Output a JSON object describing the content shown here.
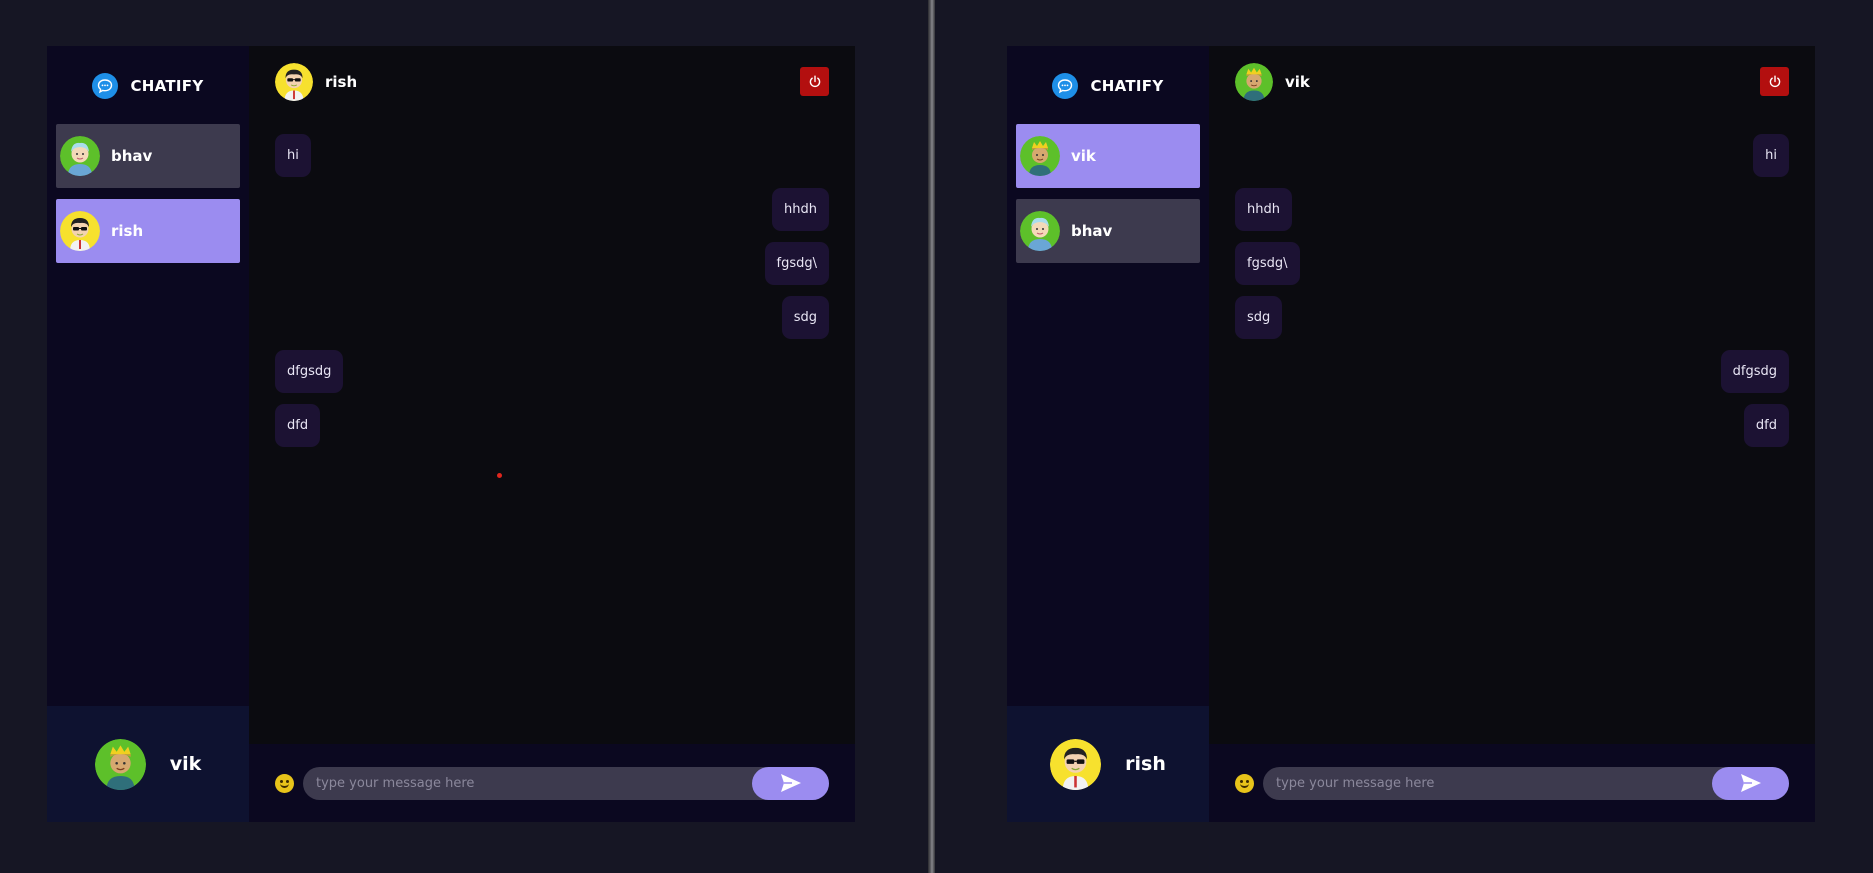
{
  "colors": {
    "background": "#161624",
    "sidebar": "#0b0820",
    "chat_bg": "#0b0b10",
    "active_contact": "#9b8cf0",
    "inactive_contact": "#3d3a4e",
    "bubble": "#1c1233",
    "logout": "#b30f0f",
    "brand_icon": "#1e8fe8"
  },
  "windows": [
    {
      "brand": {
        "name": "CHATIFY",
        "icon": "chat-bubble-icon"
      },
      "contacts": [
        {
          "name": "bhav",
          "avatar": "avatar-bhav",
          "active": false
        },
        {
          "name": "rish",
          "avatar": "avatar-rish",
          "active": true
        }
      ],
      "current_user": {
        "name": "vik",
        "avatar": "avatar-vik"
      },
      "chat": {
        "partner": {
          "name": "rish",
          "avatar": "avatar-rish"
        },
        "logout_icon": "power-icon",
        "messages": [
          {
            "text": "hi",
            "direction": "in"
          },
          {
            "text": "hhdh",
            "direction": "out"
          },
          {
            "text": "fgsdg\\",
            "direction": "out"
          },
          {
            "text": "sdg",
            "direction": "out"
          },
          {
            "text": "dfgsdg",
            "direction": "in"
          },
          {
            "text": "dfd",
            "direction": "in"
          }
        ],
        "composer": {
          "placeholder": "type your message here",
          "emoji_icon": "smiley-icon",
          "send_icon": "send-icon"
        }
      }
    },
    {
      "brand": {
        "name": "CHATIFY",
        "icon": "chat-bubble-icon"
      },
      "contacts": [
        {
          "name": "vik",
          "avatar": "avatar-vik",
          "active": true
        },
        {
          "name": "bhav",
          "avatar": "avatar-bhav",
          "active": false
        }
      ],
      "current_user": {
        "name": "rish",
        "avatar": "avatar-rish"
      },
      "chat": {
        "partner": {
          "name": "vik",
          "avatar": "avatar-vik"
        },
        "logout_icon": "power-icon",
        "messages": [
          {
            "text": "hi",
            "direction": "out"
          },
          {
            "text": "hhdh",
            "direction": "in"
          },
          {
            "text": "fgsdg\\",
            "direction": "in"
          },
          {
            "text": "sdg",
            "direction": "in"
          },
          {
            "text": "dfgsdg",
            "direction": "out"
          },
          {
            "text": "dfd",
            "direction": "out"
          }
        ],
        "composer": {
          "placeholder": "type your message here",
          "emoji_icon": "smiley-icon",
          "send_icon": "send-icon"
        }
      }
    }
  ]
}
